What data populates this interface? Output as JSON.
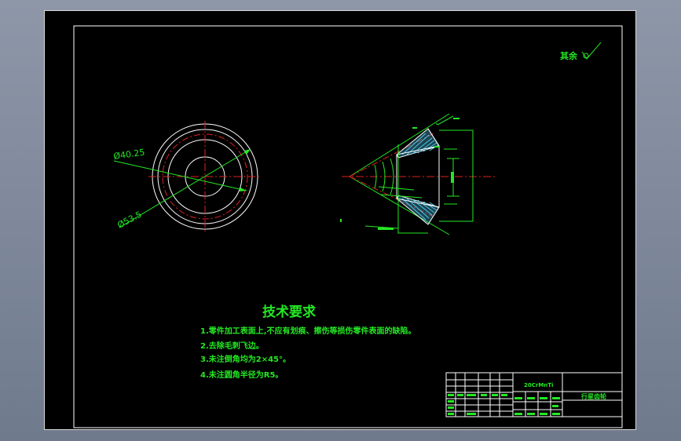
{
  "colors": {
    "background": "#000000",
    "frame": "#ffffff",
    "dimension": "#24e824",
    "centerline": "#e02020",
    "hatch": "#4fc6e8",
    "outline": "#ffffff"
  },
  "roughness_note": {
    "label": "其余",
    "symbol": "roughness-symbol-icon"
  },
  "front_view": {
    "dim_inner": "Ø40.25",
    "dim_outer": "Ø53.5"
  },
  "technical_requirements": {
    "title": "技术要求",
    "items": [
      "1.零件加工表面上,不应有划痕、擦伤等损伤零件表面的缺陷。",
      "2.去除毛刺飞边。",
      "3.未注倒角均为2×45°。",
      "4.未注圆角半径为R5。"
    ]
  },
  "title_block": {
    "material": "20CrMnTi",
    "part_name": "行星齿轮"
  }
}
